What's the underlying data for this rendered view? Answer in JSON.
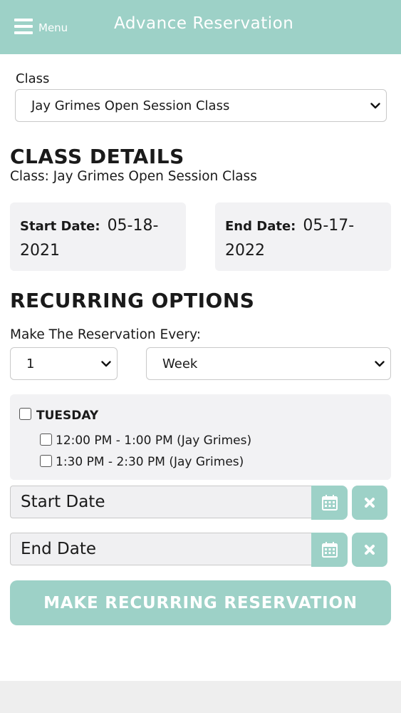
{
  "header": {
    "menu_label": "Menu",
    "title": "Advance Reservation"
  },
  "class_field": {
    "label": "Class",
    "selected": "Jay Grimes Open Session Class"
  },
  "class_details": {
    "heading": "CLASS DETAILS",
    "subtitle": "Class: Jay Grimes Open Session Class",
    "start_label": "Start Date:",
    "start_value": "05-18-2021",
    "end_label": "End Date:",
    "end_value": "05-17-2022"
  },
  "recurring": {
    "heading": "RECURRING OPTIONS",
    "every_label": "Make The Reservation Every:",
    "interval_value": "1",
    "unit_value": "Week",
    "day": {
      "label": "TUESDAY",
      "checked": false
    },
    "slots": [
      {
        "label": "12:00 PM - 1:00 PM (Jay Grimes)",
        "checked": false
      },
      {
        "label": "1:30 PM - 2:30 PM (Jay Grimes)",
        "checked": false
      }
    ],
    "start_date_placeholder": "Start Date",
    "end_date_placeholder": "End Date",
    "submit_label": "MAKE RECURRING RESERVATION"
  },
  "icons": {
    "menu": "hamburger-icon",
    "dropdown": "chevron-down-icon",
    "calendar": "calendar-icon",
    "clear": "close-icon"
  },
  "colors": {
    "accent": "#9dd1c7",
    "panel": "#f2f2f4"
  }
}
